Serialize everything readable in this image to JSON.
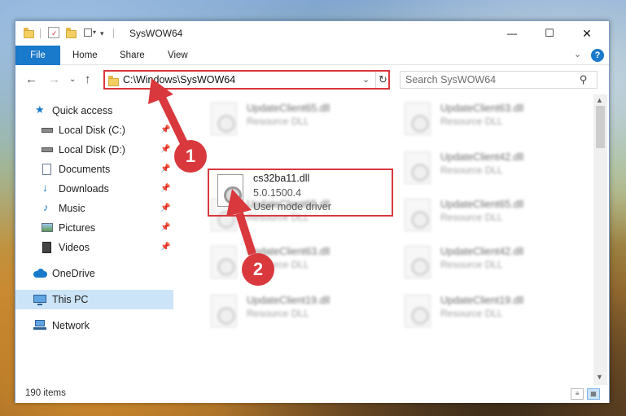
{
  "window": {
    "title": "SysWOW64"
  },
  "titlebar": {
    "minimize_icon": "minimize-icon",
    "maximize_icon": "maximize-icon",
    "close_icon": "close-icon",
    "minimize_glyph": "—",
    "maximize_glyph": "☐",
    "close_glyph": "✕"
  },
  "ribbon": {
    "tabs": [
      {
        "label": "File"
      },
      {
        "label": "Home"
      },
      {
        "label": "Share"
      },
      {
        "label": "View"
      }
    ],
    "expand_glyph": "⌄",
    "help_glyph": "?"
  },
  "navigation": {
    "back_glyph": "←",
    "forward_glyph": "→",
    "recent_glyph": "⌄",
    "up_glyph": "↑",
    "address": "C:\\Windows\\SysWOW64",
    "address_dropdown_glyph": "⌄",
    "refresh_glyph": "↻",
    "search_placeholder": "Search SysWOW64",
    "search_glyph": "⚲"
  },
  "sidebar": {
    "items": [
      {
        "label": "Quick access",
        "icon": "star-icon",
        "pinned": false
      },
      {
        "label": "Local Disk (C:)",
        "icon": "drive-icon",
        "pinned": true
      },
      {
        "label": "Local Disk (D:)",
        "icon": "drive-icon",
        "pinned": true
      },
      {
        "label": "Documents",
        "icon": "documents-icon",
        "pinned": true
      },
      {
        "label": "Downloads",
        "icon": "download-icon",
        "pinned": true
      },
      {
        "label": "Music",
        "icon": "music-icon",
        "pinned": true
      },
      {
        "label": "Pictures",
        "icon": "pictures-icon",
        "pinned": true
      },
      {
        "label": "Videos",
        "icon": "videos-icon",
        "pinned": true
      },
      {
        "label": "OneDrive",
        "icon": "cloud-icon",
        "pinned": false
      },
      {
        "label": "This PC",
        "icon": "computer-icon",
        "pinned": false,
        "selected": true
      },
      {
        "label": "Network",
        "icon": "network-icon",
        "pinned": false
      }
    ],
    "pin_glyph": "📌"
  },
  "files": {
    "left_column": [
      {
        "name": "UpdateClient65.dll",
        "type": "Resource DLL"
      },
      {
        "name": "UpdateClient65.dll",
        "type": "Resource DLL"
      },
      {
        "name": "UpdateClient63.dll",
        "type": "Resource DLL"
      },
      {
        "name": "UpdateClient19.dll",
        "type": "Resource DLL"
      }
    ],
    "right_column": [
      {
        "name": "UpdateClient63.dll",
        "type": "Resource DLL"
      },
      {
        "name": "UpdateClient42.dll",
        "type": "Resource DLL"
      },
      {
        "name": "UpdateClient65.dll",
        "type": "Resource DLL"
      },
      {
        "name": "UpdateClient42.dll",
        "type": "Resource DLL"
      },
      {
        "name": "UpdateClient19.dll",
        "type": "Resource DLL"
      }
    ],
    "highlighted": {
      "name": "cs32ba11.dll",
      "version": "5.0.1500.4",
      "description": "User mode driver"
    }
  },
  "status": {
    "item_count": "190 items"
  },
  "annotations": {
    "step1": "1",
    "step2": "2",
    "accent": "#d9383d"
  },
  "colors": {
    "accent_blue": "#1979ca",
    "selection": "#cce4f7",
    "highlight_red": "#d9383d"
  }
}
